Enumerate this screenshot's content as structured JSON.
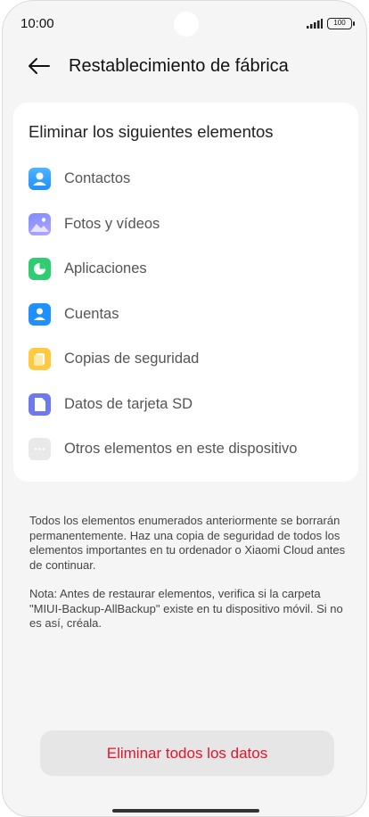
{
  "status_bar": {
    "time": "10:00",
    "battery": "100"
  },
  "header": {
    "title": "Restablecimiento de fábrica",
    "back_icon": "arrow-left-icon"
  },
  "card": {
    "title": "Eliminar los siguientes elementos",
    "items": [
      {
        "label": "Contactos",
        "icon": "contacts-icon",
        "color": "#1e90ff"
      },
      {
        "label": "Fotos y vídeos",
        "icon": "photos-icon",
        "color": "#8a8cff"
      },
      {
        "label": "Aplicaciones",
        "icon": "apps-icon",
        "color": "#2fcc71"
      },
      {
        "label": "Cuentas",
        "icon": "accounts-icon",
        "color": "#1e90ff"
      },
      {
        "label": "Copias de seguridad",
        "icon": "backup-icon",
        "color": "#ffc940"
      },
      {
        "label": "Datos de tarjeta SD",
        "icon": "sd-card-icon",
        "color": "#6f79ee"
      },
      {
        "label": "Otros elementos en este dispositivo",
        "icon": "more-icon",
        "color": "#e9e9e9"
      }
    ]
  },
  "description": {
    "warning": "Todos los elementos enumerados anteriormente se borrarán permanentemente. Haz una copia de seguridad de todos los elementos importantes en tu ordenador o Xiaomi Cloud antes de continuar.",
    "note": "Nota: Antes de restaurar elementos, verifica si la carpeta \"MIUI-Backup-AllBackup\" existe en tu dispositivo móvil. Si no es así, créala."
  },
  "actions": {
    "erase_all_label": "Eliminar todos los datos",
    "erase_color": "#e0152d"
  }
}
